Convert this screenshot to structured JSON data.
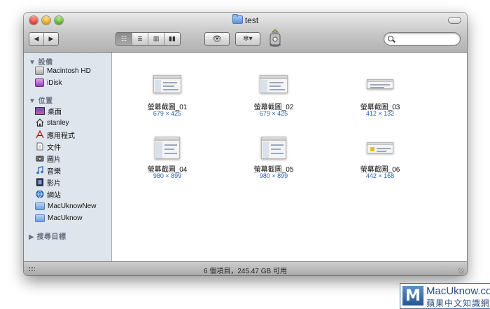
{
  "window": {
    "title": "test"
  },
  "toolbar": {
    "back_label": "◀",
    "forward_label": "▶",
    "view_icons": "☷",
    "view_list": "≣",
    "view_columns": "▥",
    "view_coverflow": "▮▮",
    "quicklook_label": "👁",
    "action_label": "✻▾",
    "search": {
      "value": "",
      "placeholder": ""
    }
  },
  "sidebar": {
    "devices_header": "▼ 設備",
    "devices": [
      {
        "label": "Macintosh HD",
        "icon": "hard-disk-icon"
      },
      {
        "label": "iDisk",
        "icon": "idisk-icon"
      }
    ],
    "places_header": "▼ 位置",
    "places": [
      {
        "label": "桌面",
        "icon": "desktop-icon"
      },
      {
        "label": "stanley",
        "icon": "home-icon"
      },
      {
        "label": "應用程式",
        "icon": "applications-icon"
      },
      {
        "label": "文件",
        "icon": "documents-icon"
      },
      {
        "label": "圖片",
        "icon": "pictures-icon"
      },
      {
        "label": "音樂",
        "icon": "music-icon"
      },
      {
        "label": "影片",
        "icon": "movies-icon"
      },
      {
        "label": "網站",
        "icon": "sites-icon"
      },
      {
        "label": "MacUknowNew",
        "icon": "folder-icon"
      },
      {
        "label": "MacUknow",
        "icon": "folder-icon"
      }
    ],
    "search_header": "▶ 搜尋目標"
  },
  "files": [
    {
      "name": "螢幕截圖_01",
      "dims": "679 × 425"
    },
    {
      "name": "螢幕截圖_02",
      "dims": "679 × 425"
    },
    {
      "name": "螢幕截圖_03",
      "dims": "412 × 132"
    },
    {
      "name": "螢幕截圖_04",
      "dims": "980 × 899"
    },
    {
      "name": "螢幕截圖_05",
      "dims": "980 × 899"
    },
    {
      "name": "螢幕截圖_06",
      "dims": "442 × 168"
    }
  ],
  "status": "6 個項目，245.47 GB 可用",
  "watermark": {
    "m": "M",
    "line1": "MacUknow.com",
    "line2": "蘋果中文知識網"
  }
}
